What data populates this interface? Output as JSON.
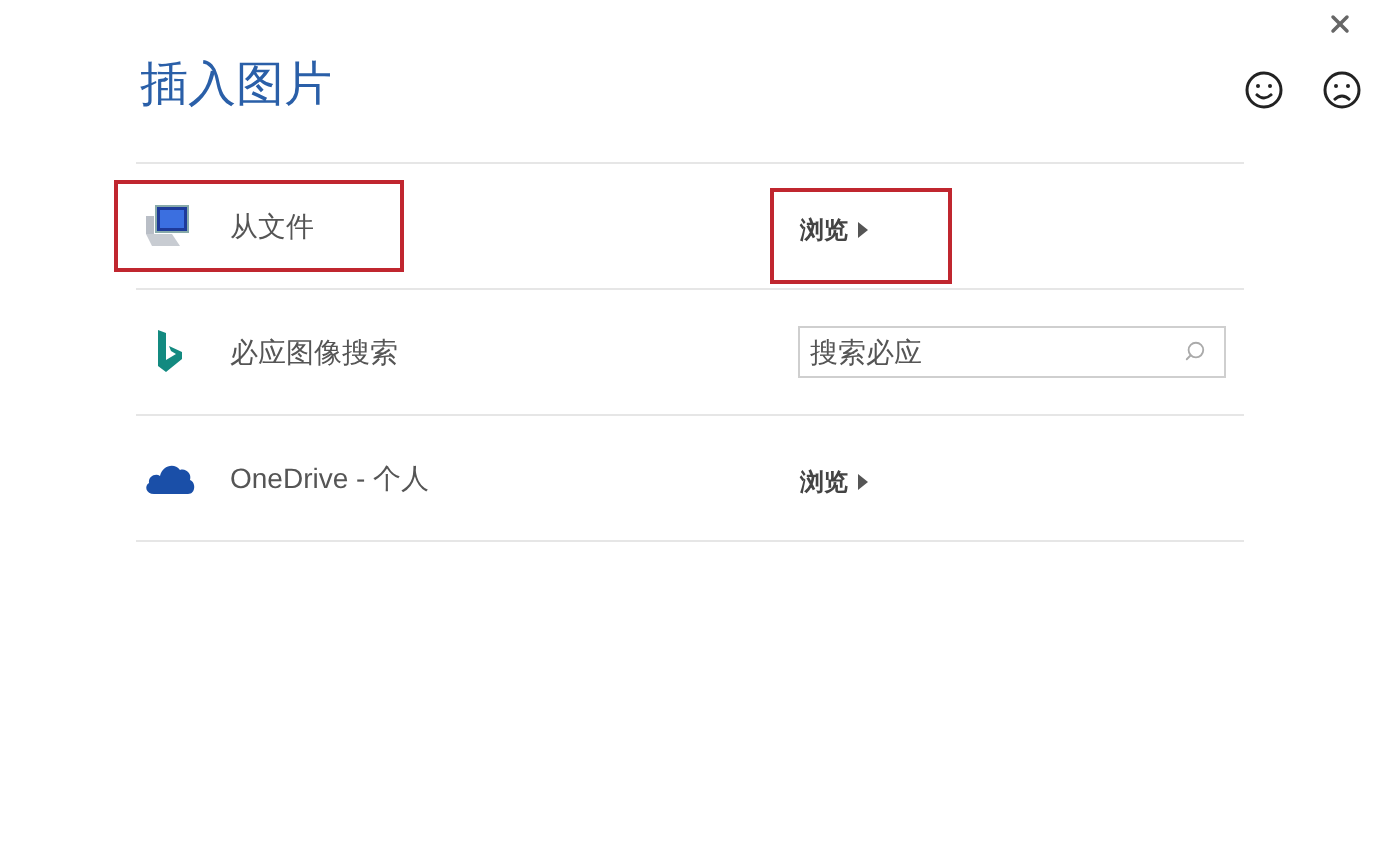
{
  "dialog": {
    "title": "插入图片"
  },
  "sources": [
    {
      "kind": "computer",
      "label": "从文件",
      "label_highlighted": true,
      "action": {
        "kind": "browse",
        "label": "浏览",
        "highlighted": true
      }
    },
    {
      "kind": "bing",
      "label": "必应图像搜索",
      "label_highlighted": false,
      "action": {
        "kind": "search",
        "placeholder": "搜索必应",
        "highlighted": false
      }
    },
    {
      "kind": "cloud",
      "label": "OneDrive - 个人",
      "label_highlighted": false,
      "action": {
        "kind": "browse",
        "label": "浏览",
        "highlighted": false
      }
    }
  ]
}
